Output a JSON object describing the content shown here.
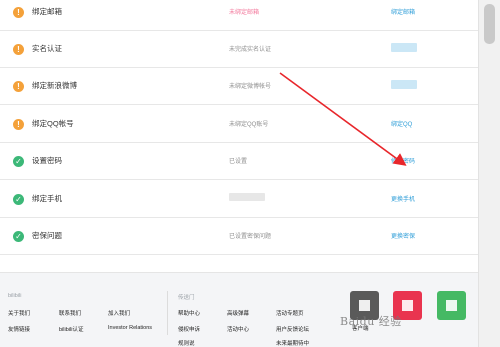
{
  "rows": [
    {
      "label": "绑定邮箱",
      "status": "未绑定邮箱",
      "action": "绑定邮箱",
      "icon": "warning-icon",
      "status_pink": true
    },
    {
      "label": "实名认证",
      "status": "未完成实名认证",
      "action": "",
      "icon": "warning-icon"
    },
    {
      "label": "绑定新浪微博",
      "status": "未绑定微博帐号",
      "action": "",
      "icon": "warning-icon"
    },
    {
      "label": "绑定QQ帐号",
      "status": "未绑定QQ账号",
      "action": "绑定QQ",
      "icon": "warning-icon"
    },
    {
      "label": "设置密码",
      "status": "已设置",
      "action": "修改密码",
      "icon": "check-icon"
    },
    {
      "label": "绑定手机",
      "status": "",
      "action": "更换手机",
      "icon": "check-icon"
    },
    {
      "label": "密保问题",
      "status": "已设置密保问题",
      "action": "更换密保",
      "icon": "check-icon"
    }
  ],
  "footer": {
    "brand": "bilibili",
    "col1": [
      "关于我们",
      "联系我们",
      "加入我们",
      "友情链接",
      "bilibili认证",
      "Investor Relations"
    ],
    "col2_title": "传送门",
    "col2": [
      "帮助中心",
      "高级弹幕",
      "活动专题页",
      "侵权申诉",
      "活动中心",
      "用户反馈论坛",
      "规则说",
      "",
      "未来最期待中"
    ],
    "apps": "客户端",
    "watermark": "Baidu 经验"
  },
  "colors": {
    "accent": "#2f9ed8",
    "warning": "#f4a13a",
    "ok": "#3cb878",
    "pink": "#f3789c",
    "arrow": "#e8262b"
  }
}
